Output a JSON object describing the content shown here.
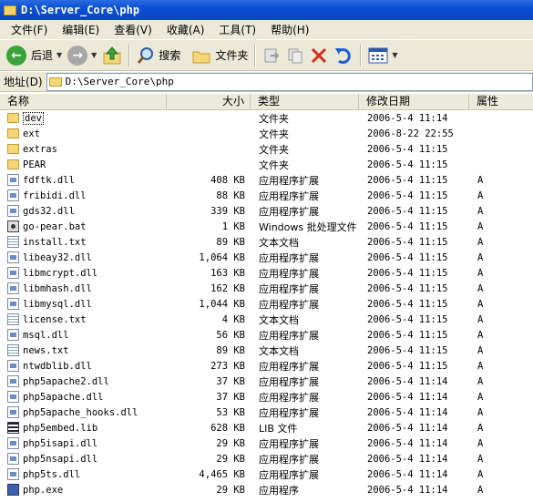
{
  "window": {
    "title": "D:\\Server_Core\\php"
  },
  "menu": [
    "文件(F)",
    "编辑(E)",
    "查看(V)",
    "收藏(A)",
    "工具(T)",
    "帮助(H)"
  ],
  "toolbar": {
    "back_label": "后退",
    "search_label": "搜索",
    "folders_label": "文件夹"
  },
  "address": {
    "label": "地址(D)",
    "value": "D:\\Server_Core\\php"
  },
  "columns": {
    "name": "名称",
    "size": "大小",
    "type": "类型",
    "modified": "修改日期",
    "attributes": "属性"
  },
  "files": [
    {
      "name": "dev",
      "size": "",
      "type": "文件夹",
      "date": "2006-5-4 11:14",
      "attr": "",
      "icon": "folder-icon"
    },
    {
      "name": "ext",
      "size": "",
      "type": "文件夹",
      "date": "2006-8-22 22:55",
      "attr": "",
      "icon": "folder-icon"
    },
    {
      "name": "extras",
      "size": "",
      "type": "文件夹",
      "date": "2006-5-4 11:15",
      "attr": "",
      "icon": "folder-icon"
    },
    {
      "name": "PEAR",
      "size": "",
      "type": "文件夹",
      "date": "2006-5-4 11:15",
      "attr": "",
      "icon": "folder-icon"
    },
    {
      "name": "fdftk.dll",
      "size": "408 KB",
      "type": "应用程序扩展",
      "date": "2006-5-4 11:15",
      "attr": "A",
      "icon": "dll-icon"
    },
    {
      "name": "fribidi.dll",
      "size": "88 KB",
      "type": "应用程序扩展",
      "date": "2006-5-4 11:15",
      "attr": "A",
      "icon": "dll-icon"
    },
    {
      "name": "gds32.dll",
      "size": "339 KB",
      "type": "应用程序扩展",
      "date": "2006-5-4 11:15",
      "attr": "A",
      "icon": "dll-icon"
    },
    {
      "name": "go-pear.bat",
      "size": "1 KB",
      "type": "Windows 批处理文件",
      "date": "2006-5-4 11:15",
      "attr": "A",
      "icon": "batch-icon"
    },
    {
      "name": "install.txt",
      "size": "89 KB",
      "type": "文本文档",
      "date": "2006-5-4 11:15",
      "attr": "A",
      "icon": "text-icon"
    },
    {
      "name": "libeay32.dll",
      "size": "1,064 KB",
      "type": "应用程序扩展",
      "date": "2006-5-4 11:15",
      "attr": "A",
      "icon": "dll-icon"
    },
    {
      "name": "libmcrypt.dll",
      "size": "163 KB",
      "type": "应用程序扩展",
      "date": "2006-5-4 11:15",
      "attr": "A",
      "icon": "dll-icon"
    },
    {
      "name": "libmhash.dll",
      "size": "162 KB",
      "type": "应用程序扩展",
      "date": "2006-5-4 11:15",
      "attr": "A",
      "icon": "dll-icon"
    },
    {
      "name": "libmysql.dll",
      "size": "1,044 KB",
      "type": "应用程序扩展",
      "date": "2006-5-4 11:15",
      "attr": "A",
      "icon": "dll-icon"
    },
    {
      "name": "license.txt",
      "size": "4 KB",
      "type": "文本文档",
      "date": "2006-5-4 11:15",
      "attr": "A",
      "icon": "text-icon"
    },
    {
      "name": "msql.dll",
      "size": "56 KB",
      "type": "应用程序扩展",
      "date": "2006-5-4 11:15",
      "attr": "A",
      "icon": "dll-icon"
    },
    {
      "name": "news.txt",
      "size": "89 KB",
      "type": "文本文档",
      "date": "2006-5-4 11:15",
      "attr": "A",
      "icon": "text-icon"
    },
    {
      "name": "ntwdblib.dll",
      "size": "273 KB",
      "type": "应用程序扩展",
      "date": "2006-5-4 11:15",
      "attr": "A",
      "icon": "dll-icon"
    },
    {
      "name": "php5apache2.dll",
      "size": "37 KB",
      "type": "应用程序扩展",
      "date": "2006-5-4 11:14",
      "attr": "A",
      "icon": "dll-icon"
    },
    {
      "name": "php5apache.dll",
      "size": "37 KB",
      "type": "应用程序扩展",
      "date": "2006-5-4 11:14",
      "attr": "A",
      "icon": "dll-icon"
    },
    {
      "name": "php5apache_hooks.dll",
      "size": "53 KB",
      "type": "应用程序扩展",
      "date": "2006-5-4 11:14",
      "attr": "A",
      "icon": "dll-icon"
    },
    {
      "name": "php5embed.lib",
      "size": "628 KB",
      "type": "LIB 文件",
      "date": "2006-5-4 11:14",
      "attr": "A",
      "icon": "lib-icon"
    },
    {
      "name": "php5isapi.dll",
      "size": "29 KB",
      "type": "应用程序扩展",
      "date": "2006-5-4 11:14",
      "attr": "A",
      "icon": "dll-icon"
    },
    {
      "name": "php5nsapi.dll",
      "size": "29 KB",
      "type": "应用程序扩展",
      "date": "2006-5-4 11:14",
      "attr": "A",
      "icon": "dll-icon"
    },
    {
      "name": "php5ts.dll",
      "size": "4,465 KB",
      "type": "应用程序扩展",
      "date": "2006-5-4 11:14",
      "attr": "A",
      "icon": "dll-icon"
    },
    {
      "name": "php.exe",
      "size": "29 KB",
      "type": "应用程序",
      "date": "2006-5-4 11:14",
      "attr": "A",
      "icon": "exe-icon"
    }
  ]
}
